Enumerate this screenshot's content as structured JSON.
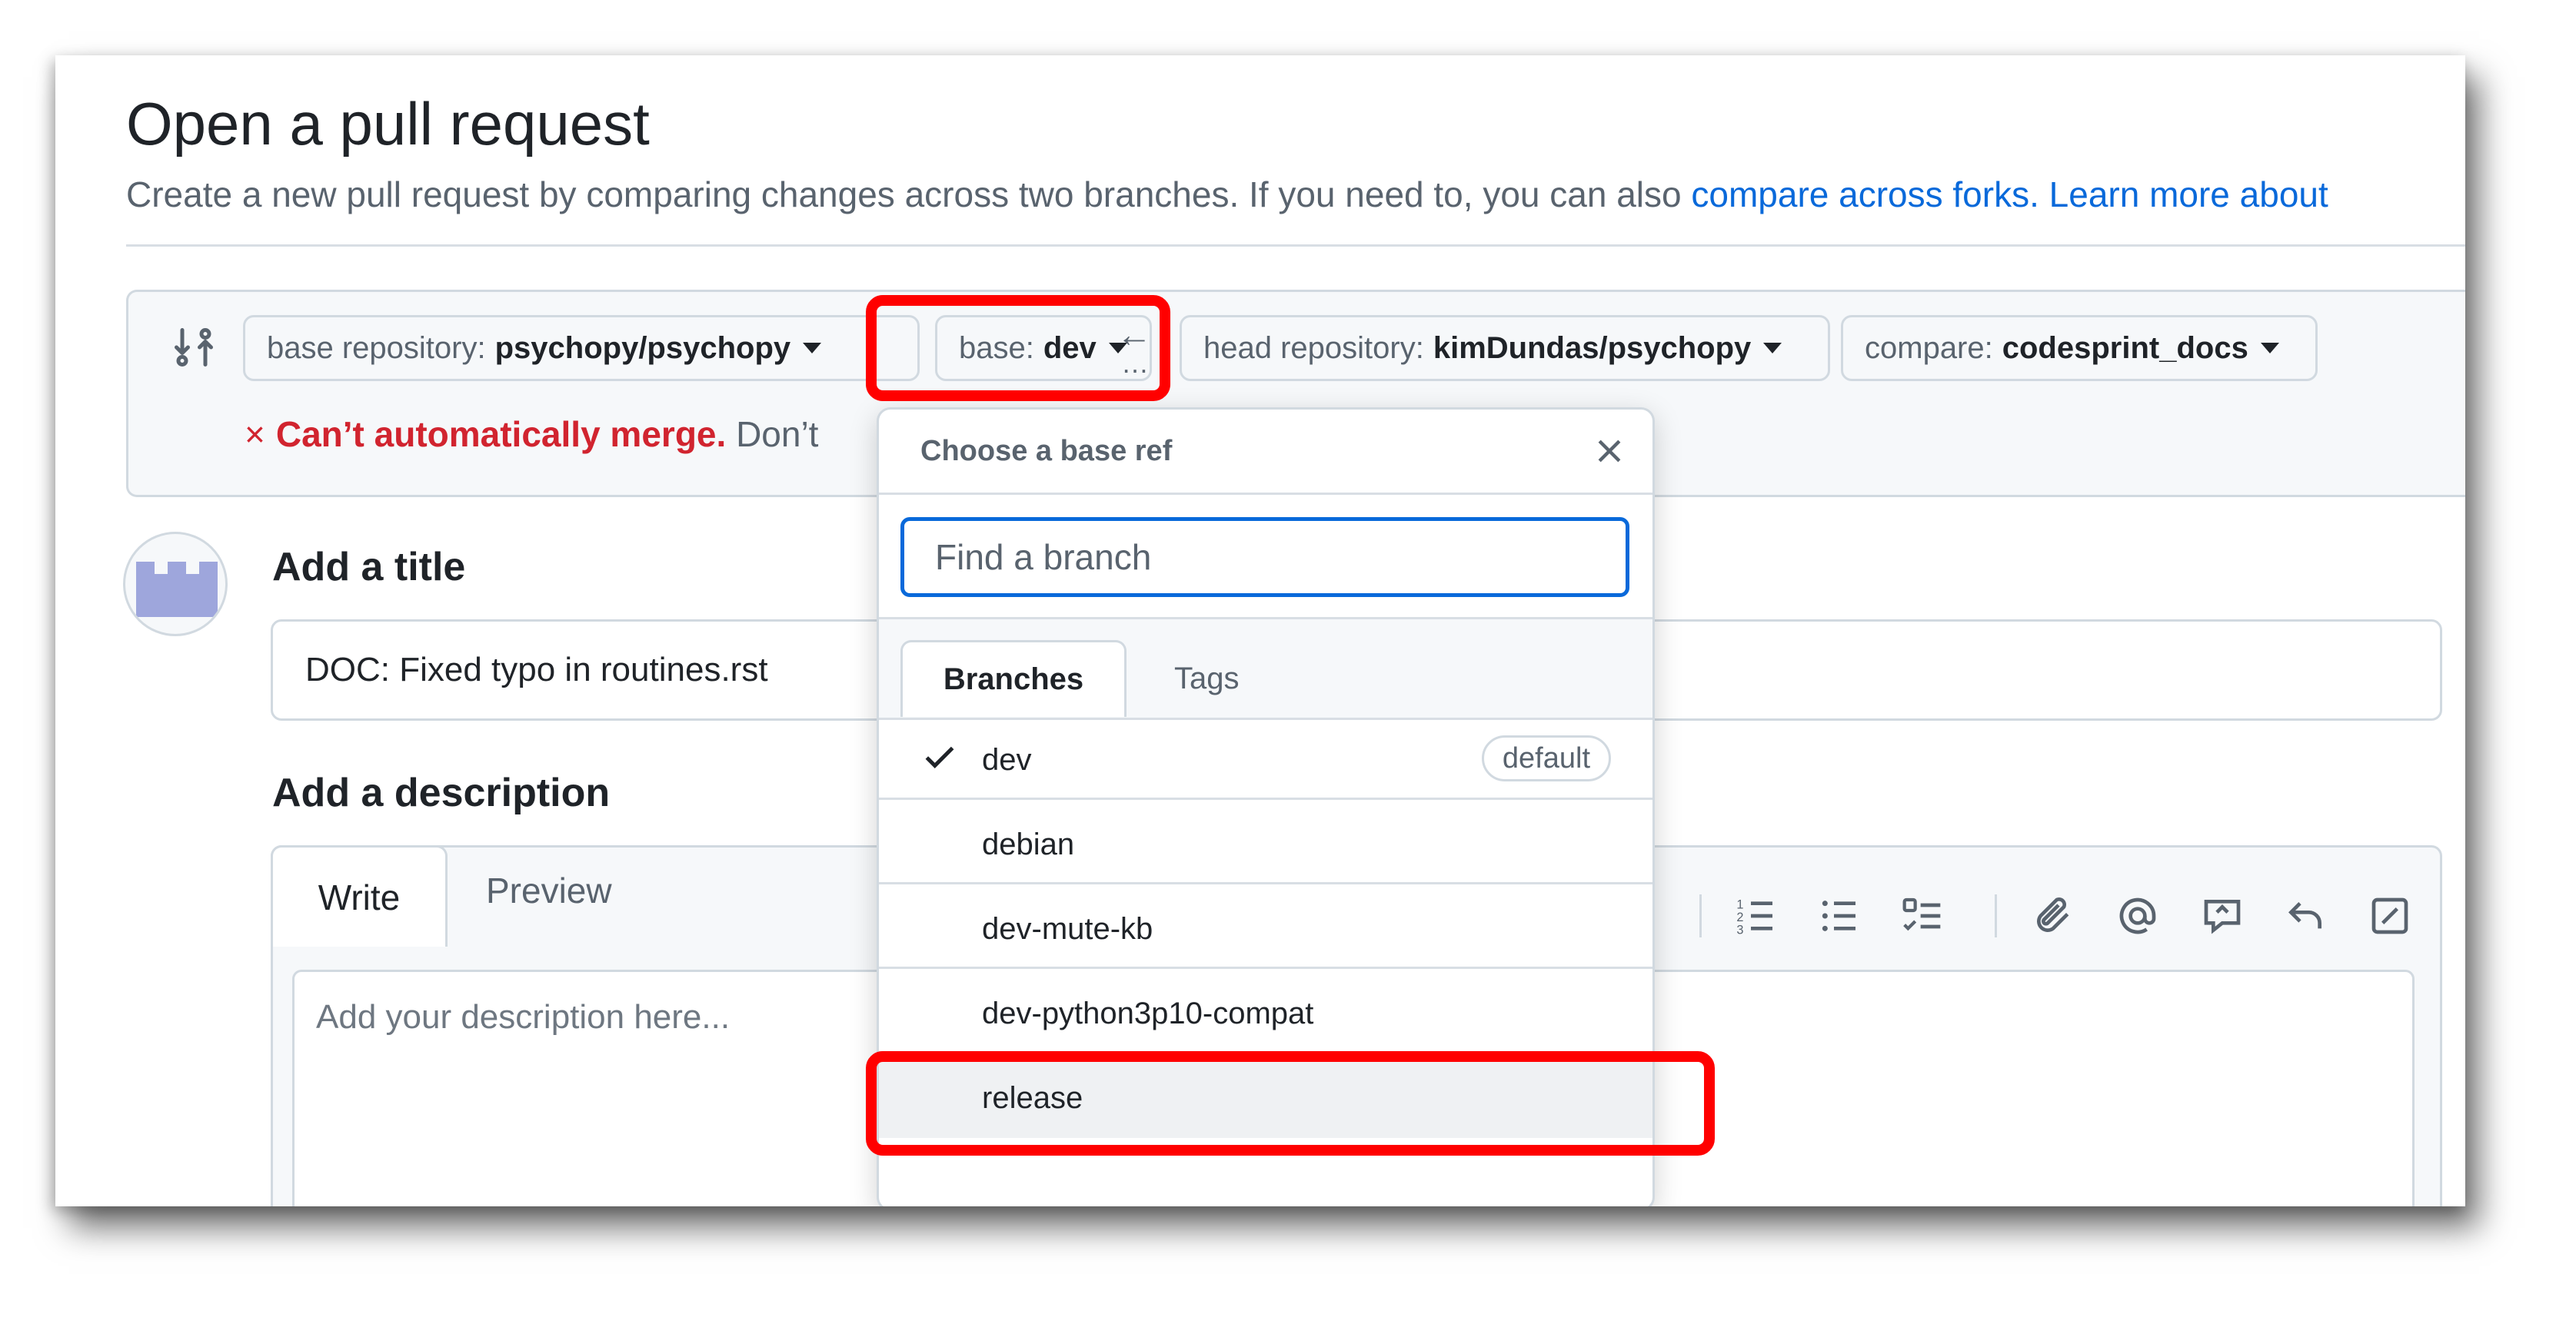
{
  "page": {
    "title": "Open a pull request",
    "subtitle_prefix": "Create a new pull request by comparing changes across two branches. If you need to, you can also ",
    "compare_forks_link": "compare across forks.",
    "learn_more_link": "Learn more about"
  },
  "compare": {
    "base_repo_label": "base repository:",
    "base_repo_value": "psychopy/psychopy",
    "base_label": "base:",
    "base_value": "dev",
    "arrow_glyph": "←",
    "dots_glyph": "…",
    "head_repo_label": "head repository:",
    "head_repo_value": "kimDundas/psychopy",
    "compare_label": "compare:",
    "compare_value": "codesprint_docs",
    "merge_icon": "×",
    "merge_status": "Can’t automatically merge.",
    "merge_hint": "Don’t"
  },
  "form": {
    "title_heading": "Add a title",
    "title_value": "DOC: Fixed typo in routines.rst",
    "desc_heading": "Add a description",
    "tab_write": "Write",
    "tab_preview": "Preview",
    "desc_placeholder": "Add your description here...",
    "toolbar_icons": [
      "link-icon",
      "ordered-list-icon",
      "unordered-list-icon",
      "task-list-icon",
      "attach-icon",
      "mention-icon",
      "reference-icon",
      "undo-icon",
      "slash-command-icon"
    ]
  },
  "dropdown": {
    "header": "Choose a base ref",
    "search_placeholder": "Find a branch",
    "tab_branches": "Branches",
    "tab_tags": "Tags",
    "items": [
      {
        "label": "dev",
        "selected": true,
        "badge": "default"
      },
      {
        "label": "debian"
      },
      {
        "label": "dev-mute-kb"
      },
      {
        "label": "dev-python3p10-compat"
      },
      {
        "label": "release",
        "hovered": true
      }
    ]
  },
  "colors": {
    "link": "#0969da",
    "error": "#d1242f",
    "highlight": "#ff0000",
    "avatar": "#9ea6dc"
  }
}
